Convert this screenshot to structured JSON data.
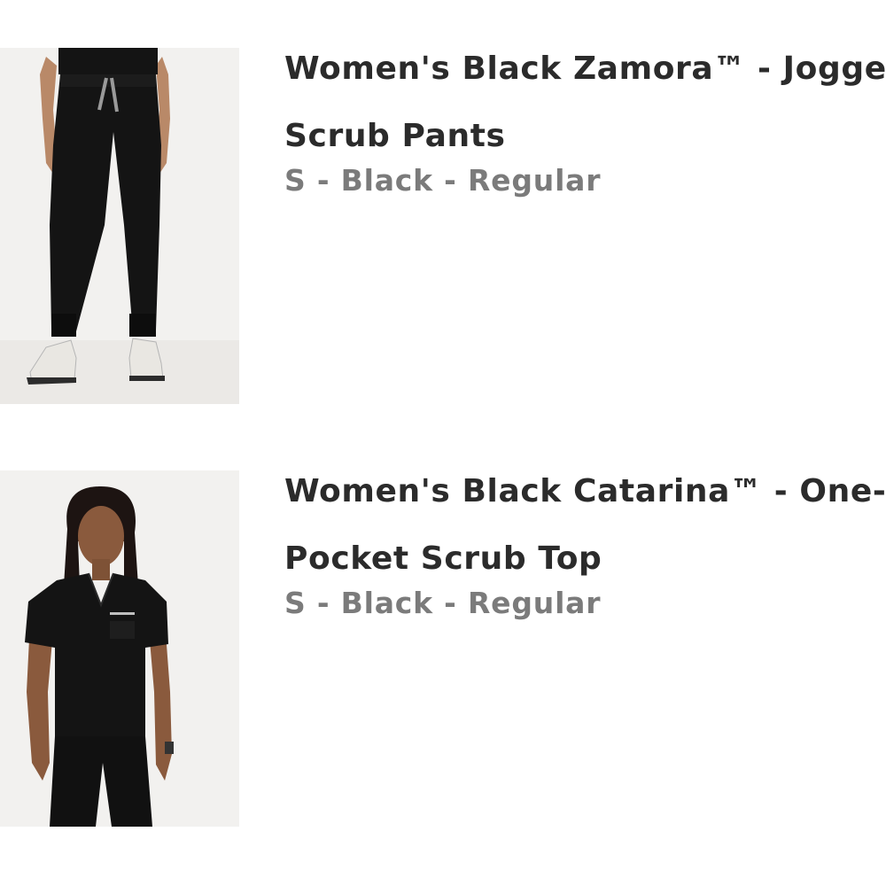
{
  "cart_items": [
    {
      "title": "Women's Black Zamora™ - Jogger Scrub Pants",
      "variant": "S - Black - Regular",
      "image_icon": "product-thumbnail-pants"
    },
    {
      "title": "Women's Black Catarina™ - One-Pocket Scrub Top",
      "variant": "S - Black - Regular",
      "image_icon": "product-thumbnail-top"
    }
  ],
  "colors": {
    "title": "#2b2b2b",
    "variant": "#7b7b7b",
    "thumb_bg": "#f2f1ef",
    "garment": "#141414"
  }
}
